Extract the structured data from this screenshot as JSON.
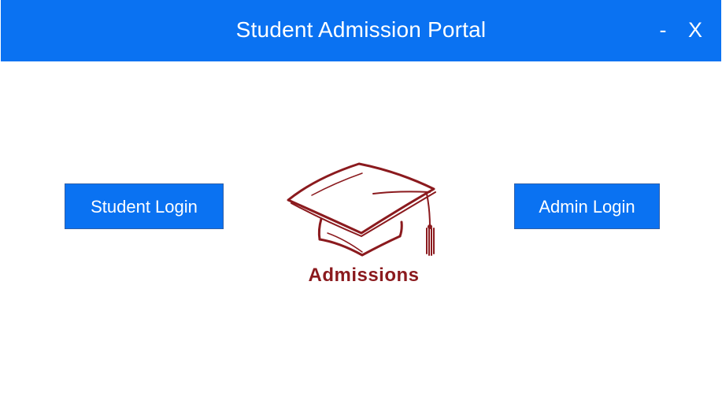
{
  "window": {
    "title": "Student Admission Portal",
    "minimize_label": "-",
    "close_label": "X"
  },
  "buttons": {
    "student_login": "Student Login",
    "admin_login": "Admin Login"
  },
  "logo": {
    "icon": "graduation-cap-icon",
    "text": "Admissions",
    "color": "#8b1a1e"
  },
  "colors": {
    "accent": "#0a72f2",
    "background": "#ffffff",
    "text_on_accent": "#ffffff"
  }
}
